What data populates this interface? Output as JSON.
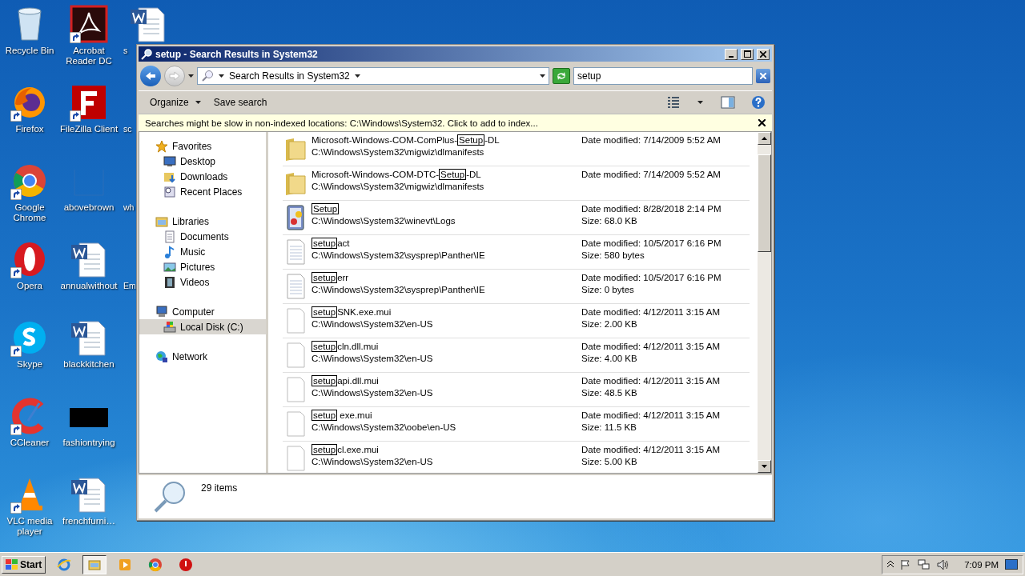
{
  "desktop": {
    "icons": [
      {
        "label": "Recycle Bin",
        "kind": "recycle",
        "shortcut": false
      },
      {
        "label": "Firefox",
        "kind": "firefox",
        "shortcut": true
      },
      {
        "label": "Google Chrome",
        "kind": "chrome",
        "shortcut": true
      },
      {
        "label": "Opera",
        "kind": "opera",
        "shortcut": true
      },
      {
        "label": "Skype",
        "kind": "skype",
        "shortcut": true
      },
      {
        "label": "CCleaner",
        "kind": "ccleaner",
        "shortcut": true
      },
      {
        "label": "VLC media player",
        "kind": "vlc",
        "shortcut": true
      },
      {
        "label": "Acrobat Reader DC",
        "kind": "acrobat",
        "shortcut": true
      },
      {
        "label": "FileZilla Client",
        "kind": "filezilla",
        "shortcut": true
      },
      {
        "label": "abovebrown",
        "kind": "blank",
        "shortcut": false
      },
      {
        "label": "annualwithout",
        "kind": "word",
        "shortcut": false
      },
      {
        "label": "blackkitchen",
        "kind": "word",
        "shortcut": false
      },
      {
        "label": "fashiontrying",
        "kind": "black",
        "shortcut": false
      },
      {
        "label": "frenchfurni…",
        "kind": "word",
        "shortcut": false
      },
      {
        "label": "s",
        "kind": "word",
        "shortcut": false
      },
      {
        "label": "sc",
        "kind": "none",
        "shortcut": false
      },
      {
        "label": "wh",
        "kind": "none",
        "shortcut": false
      },
      {
        "label": "Em",
        "kind": "none",
        "shortcut": false
      }
    ]
  },
  "window": {
    "title": "setup - Search Results in System32",
    "address": {
      "crumb": "Search Results in System32"
    },
    "search": {
      "value": "setup"
    },
    "toolbar": {
      "buttons": [
        {
          "label": "Organize",
          "dropdown": true
        },
        {
          "label": "Save search",
          "dropdown": false
        }
      ]
    },
    "infobar": {
      "text": "Searches might be slow in non-indexed locations: C:\\Windows\\System32. Click to add to index..."
    },
    "sidebar": [
      {
        "label": "Favorites",
        "kind": "favorites",
        "selected": false,
        "children": [
          {
            "label": "Desktop",
            "kind": "desktop",
            "selected": false
          },
          {
            "label": "Downloads",
            "kind": "downloads",
            "selected": false
          },
          {
            "label": "Recent Places",
            "kind": "recent",
            "selected": false
          }
        ]
      },
      {
        "label": "Libraries",
        "kind": "libraries",
        "selected": false,
        "children": [
          {
            "label": "Documents",
            "kind": "documents",
            "selected": false
          },
          {
            "label": "Music",
            "kind": "music",
            "selected": false
          },
          {
            "label": "Pictures",
            "kind": "pictures",
            "selected": false
          },
          {
            "label": "Videos",
            "kind": "videos",
            "selected": false
          }
        ]
      },
      {
        "label": "Computer",
        "kind": "computer",
        "selected": false,
        "children": [
          {
            "label": "Local Disk (C:)",
            "kind": "disk",
            "selected": true
          }
        ]
      },
      {
        "label": "Network",
        "kind": "network",
        "selected": false
      }
    ],
    "results": [
      {
        "kind": "folder",
        "before": "Microsoft-Windows-COM-ComPlus-",
        "match": "Setup",
        "after": "-DL",
        "path": "C:\\Windows\\System32\\migwiz\\dlmanifests",
        "date": "Date modified: 7/14/2009 5:52 AM"
      },
      {
        "kind": "folder",
        "before": "Microsoft-Windows-COM-DTC-",
        "match": "Setup",
        "after": "-DL",
        "path": "C:\\Windows\\System32\\migwiz\\dlmanifests",
        "date": "Date modified: 7/14/2009 5:52 AM"
      },
      {
        "kind": "log",
        "match": "Setup",
        "path": "C:\\Windows\\System32\\winevt\\Logs",
        "date": "Date modified: 8/28/2018 2:14 PM",
        "size": "Size: 68.0 KB"
      },
      {
        "kind": "text",
        "match": "setup",
        "after": "act",
        "path": "C:\\Windows\\System32\\sysprep\\Panther\\IE",
        "date": "Date modified: 10/5/2017 6:16 PM",
        "size": "Size: 580 bytes"
      },
      {
        "kind": "text",
        "match": "setup",
        "after": "err",
        "path": "C:\\Windows\\System32\\sysprep\\Panther\\IE",
        "date": "Date modified: 10/5/2017 6:16 PM",
        "size": "Size: 0 bytes"
      },
      {
        "kind": "file",
        "match": "setup",
        "after": "SNK.exe.mui",
        "path": "C:\\Windows\\System32\\en-US",
        "date": "Date modified: 4/12/2011 3:15 AM",
        "size": "Size: 2.00 KB"
      },
      {
        "kind": "file",
        "match": "setup",
        "after": "cln.dll.mui",
        "path": "C:\\Windows\\System32\\en-US",
        "date": "Date modified: 4/12/2011 3:15 AM",
        "size": "Size: 4.00 KB"
      },
      {
        "kind": "file",
        "match": "setup",
        "after": "api.dll.mui",
        "path": "C:\\Windows\\System32\\en-US",
        "date": "Date modified: 4/12/2011 3:15 AM",
        "size": "Size: 48.5 KB"
      },
      {
        "kind": "file",
        "match": "setup",
        "after": " exe.mui",
        "path": "C:\\Windows\\System32\\oobe\\en-US",
        "date": "Date modified: 4/12/2011 3:15 AM",
        "size": "Size: 11.5 KB"
      },
      {
        "kind": "file",
        "match": "setup",
        "after": "cl.exe.mui",
        "path": "C:\\Windows\\System32\\en-US",
        "date": "Date modified: 4/12/2011 3:15 AM",
        "size": "Size: 5.00 KB"
      }
    ],
    "details": {
      "count": "29 items"
    }
  },
  "taskbar": {
    "start": "Start",
    "apps": [
      {
        "kind": "ie",
        "selected": false
      },
      {
        "kind": "explorer",
        "selected": true
      },
      {
        "kind": "media",
        "selected": false
      },
      {
        "kind": "chrome",
        "selected": false
      },
      {
        "kind": "opera",
        "selected": false
      }
    ],
    "clock": "7:09 PM"
  }
}
